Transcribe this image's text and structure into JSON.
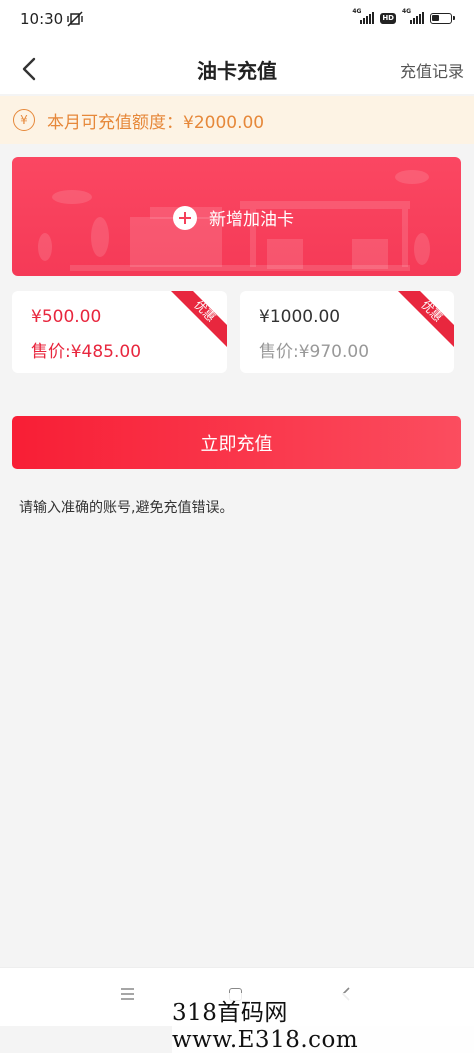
{
  "status_bar": {
    "time": "10:30",
    "net1": "4G",
    "hd": "HD",
    "net2": "4G",
    "battery_level": 0.4
  },
  "nav": {
    "title": "油卡充值",
    "record_link": "充值记录"
  },
  "quota": {
    "icon_symbol": "¥",
    "text": "本月可充值额度：¥2000.00"
  },
  "add_card": {
    "label": "新增加油卡"
  },
  "options": [
    {
      "face": "¥500.00",
      "price": "售价:¥485.00",
      "badge": "优惠",
      "selected": true
    },
    {
      "face": "¥1000.00",
      "price": "售价:¥970.00",
      "badge": "优惠",
      "selected": false
    }
  ],
  "action": {
    "recharge_label": "立即充值"
  },
  "tip": "请输入准确的账号,避免充值错误。",
  "watermark": "318首码网 www.E318.com",
  "colors": {
    "accent": "#f5405a",
    "orange": "#e6883a",
    "quota_bg": "#fdf3e4"
  }
}
